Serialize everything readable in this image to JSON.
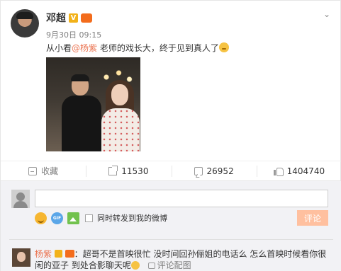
{
  "post": {
    "author": "邓超",
    "verified_badge": "V",
    "member_badge": "会员",
    "timestamp": "9月30日 09:15",
    "text_before": "从小看",
    "mention": "@杨紫",
    "text_after": " 老师的戏长大，终于见到真人了",
    "menu_icon": "chevron-down-icon",
    "photo_description_icon": "photo"
  },
  "actions": {
    "favorite_label": "收藏",
    "repost_count": "11530",
    "comment_count": "26952",
    "like_count": "1404740"
  },
  "composer": {
    "input_value": "",
    "input_placeholder": "",
    "gif_label": "GIF",
    "repost_label": "同时转发到我的微博",
    "submit_label": "评论"
  },
  "reply": {
    "author": "杨紫",
    "text": "：超哥不是首映很忙 没时间回孙俪姐的电话么 怎么首映时候看你很闲的亚子 到处合影聊天呢",
    "action_label": "评论配图"
  },
  "colors": {
    "accent": "#eb7350",
    "button_disabled": "#ffc09f",
    "panel_bg": "#f2f2f5"
  }
}
